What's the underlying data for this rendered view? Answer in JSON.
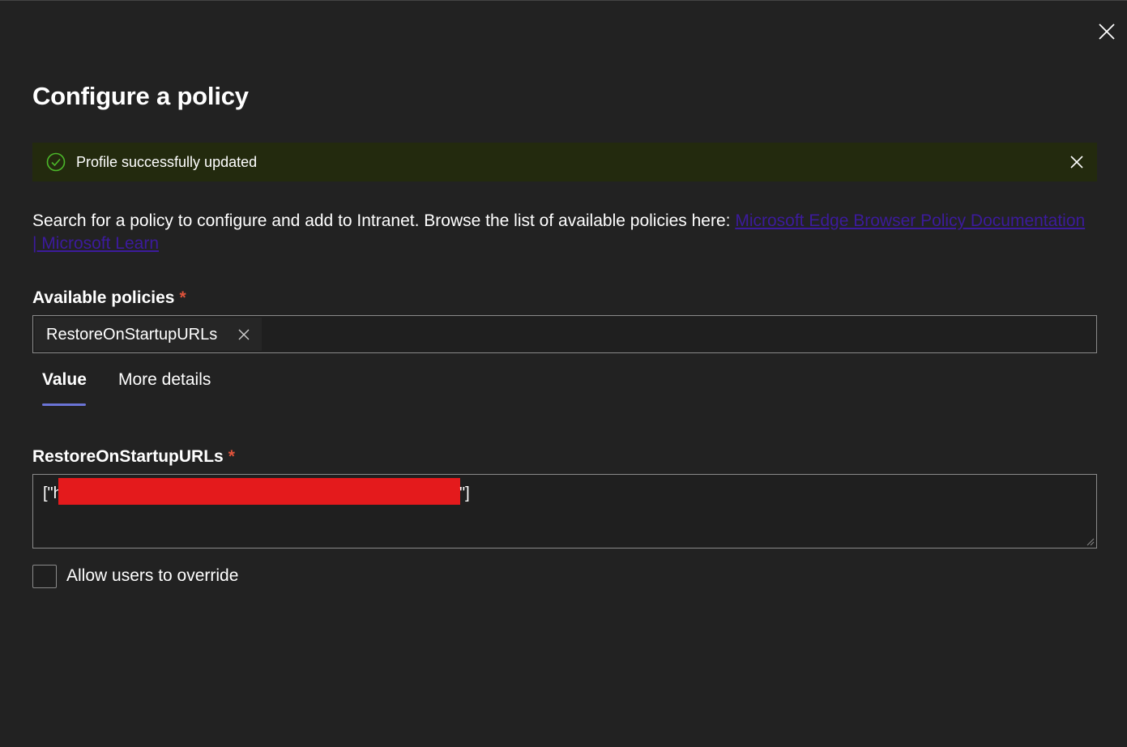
{
  "panel": {
    "title": "Configure a policy",
    "close_icon": "close-icon"
  },
  "banner": {
    "message": "Profile successfully updated",
    "status_icon": "check-circle-icon",
    "dismiss_icon": "close-icon",
    "background": "#232a0e",
    "accent": "#4cb82a"
  },
  "description": {
    "text": "Search for a policy to configure and add to Intranet. Browse the list of available policies here: ",
    "link_text": "Microsoft Edge Browser Policy Documentation | Microsoft Learn",
    "link_color": "#3c1b9c"
  },
  "available_policies": {
    "label": "Available policies",
    "required_mark": "*",
    "selected": "RestoreOnStartupURLs",
    "remove_icon": "close-icon"
  },
  "tabs": [
    {
      "label": "Value",
      "active": true
    },
    {
      "label": "More details",
      "active": false
    }
  ],
  "value_field": {
    "label": "RestoreOnStartupURLs",
    "required_mark": "*",
    "value_prefix": "[\"h",
    "value_suffix": "\"]",
    "redaction_color": "#e41a1c"
  },
  "override": {
    "label": "Allow users to override",
    "checked": false
  },
  "colors": {
    "background": "#222222",
    "required": "#e0533b",
    "tab_indicator": "#6b74d6",
    "border": "#8a8a8a"
  }
}
